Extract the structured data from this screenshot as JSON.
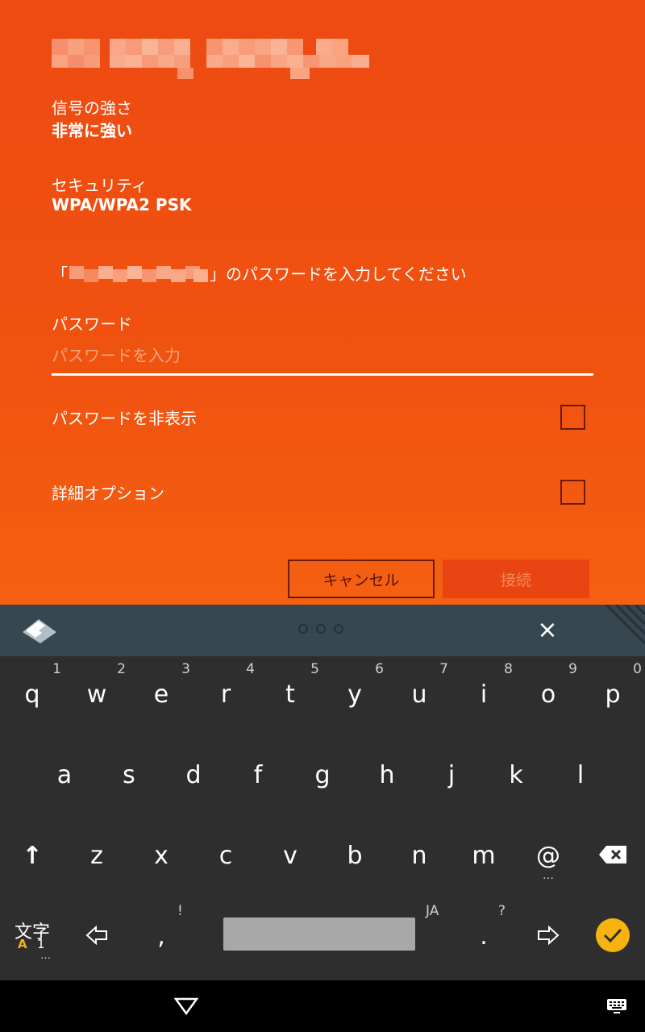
{
  "dialog": {
    "signal_label": "信号の強さ",
    "signal_value": "非常に強い",
    "security_label": "セキュリティ",
    "security_value": "WPA/WPA2 PSK",
    "prompt_open": "「",
    "prompt_close": "」のパスワードを入力してください",
    "password_label": "パスワード",
    "password_placeholder": "パスワードを入力",
    "hide_password_label": "パスワードを非表示",
    "advanced_options_label": "詳細オプション",
    "cancel_label": "キャンセル",
    "connect_label": "接続"
  },
  "keyboard": {
    "close_symbol": "×",
    "row1": [
      {
        "key": "q",
        "hint": "1"
      },
      {
        "key": "w",
        "hint": "2"
      },
      {
        "key": "e",
        "hint": "3"
      },
      {
        "key": "r",
        "hint": "4"
      },
      {
        "key": "t",
        "hint": "5"
      },
      {
        "key": "y",
        "hint": "6"
      },
      {
        "key": "u",
        "hint": "7"
      },
      {
        "key": "i",
        "hint": "8"
      },
      {
        "key": "o",
        "hint": "9"
      },
      {
        "key": "p",
        "hint": "0"
      }
    ],
    "row2": [
      "a",
      "s",
      "d",
      "f",
      "g",
      "h",
      "j",
      "k",
      "l"
    ],
    "row3": [
      "z",
      "x",
      "c",
      "v",
      "b",
      "n",
      "m",
      "@"
    ],
    "at_more": "…",
    "mode_label": "文字",
    "mode_sub_a": "A",
    "mode_sub_1": "1",
    "mode_more": "…",
    "comma": ",",
    "comma_hint": "!",
    "lang_hint": "JA",
    "period": ".",
    "period_hint": "?",
    "shift_symbol": "↑"
  },
  "colors": {
    "accent": "#f0520f",
    "keyboard_bg": "#2e2e2e",
    "toolbar_bg": "#37474f",
    "enter_key": "#f6b20f"
  }
}
